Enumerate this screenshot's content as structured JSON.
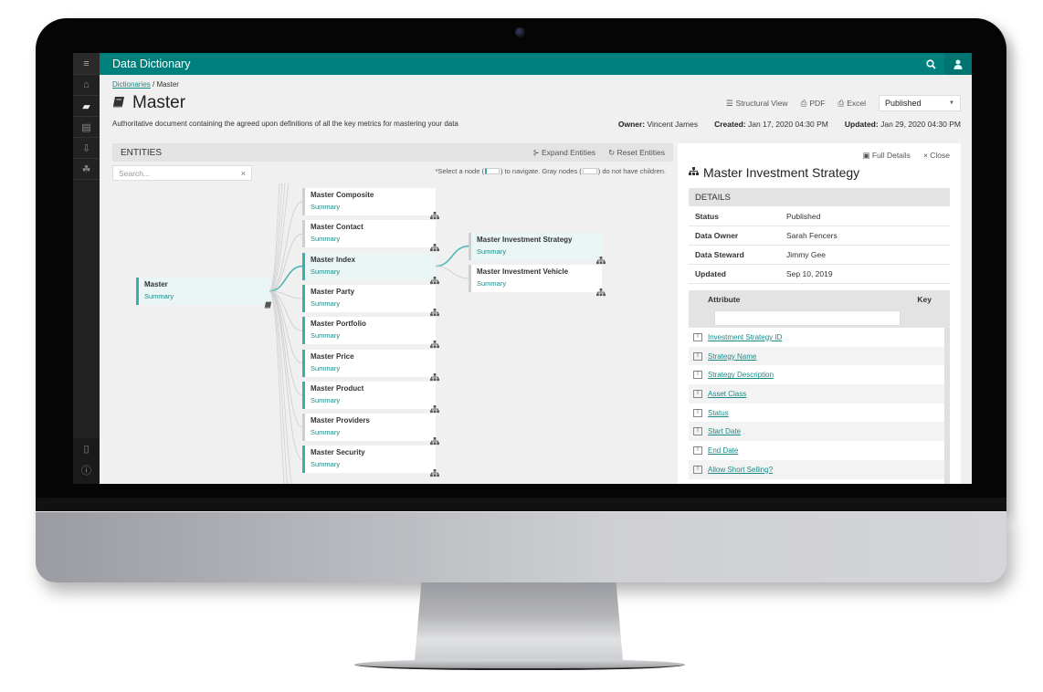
{
  "app": {
    "title": "Data Dictionary"
  },
  "sidebar": {
    "items": [
      {
        "name": "menu",
        "glyph": "≡"
      },
      {
        "name": "home",
        "glyph": "⌂"
      },
      {
        "name": "dictionaries",
        "glyph": "▰"
      },
      {
        "name": "documents",
        "glyph": "▤"
      },
      {
        "name": "import",
        "glyph": "⇩"
      },
      {
        "name": "groups",
        "glyph": "☘"
      }
    ],
    "bottom": [
      {
        "name": "device",
        "glyph": "▯"
      },
      {
        "name": "info",
        "glyph": "ⓘ"
      }
    ]
  },
  "breadcrumb": {
    "root": "Dictionaries",
    "separator": "/",
    "current": "Master"
  },
  "page": {
    "title": "Master",
    "description": "Authoritative document containing the agreed upon definitions of all the key metrics for mastering your data",
    "actions": {
      "structural_view": "Structural View",
      "pdf": "PDF",
      "excel": "Excel"
    },
    "status_select": "Published",
    "meta": {
      "owner_label": "Owner:",
      "owner": "Vincent James",
      "created_label": "Created:",
      "created": "Jan 17, 2020 04:30 PM",
      "updated_label": "Updated:",
      "updated": "Jan 29, 2020 04:30 PM"
    }
  },
  "entities": {
    "title": "ENTITIES",
    "expand": "Expand Entities",
    "reset": "Reset Entities",
    "search_placeholder": "Search...",
    "hint_a": "*Select a node (",
    "hint_b": ") to navigate. Gray nodes (",
    "hint_c": ") do not have children.",
    "root": {
      "title": "Master",
      "summary": "Summary"
    },
    "children": [
      {
        "title": "Master Composite",
        "summary": "Summary",
        "gray": true
      },
      {
        "title": "Master Contact",
        "summary": "Summary",
        "gray": true
      },
      {
        "title": "Master Index",
        "summary": "Summary",
        "gray": false,
        "selected": true
      },
      {
        "title": "Master Party",
        "summary": "Summary",
        "gray": false
      },
      {
        "title": "Master Portfolio",
        "summary": "Summary",
        "gray": false
      },
      {
        "title": "Master Price",
        "summary": "Summary",
        "gray": false
      },
      {
        "title": "Master Product",
        "summary": "Summary",
        "gray": false
      },
      {
        "title": "Master Providers",
        "summary": "Summary",
        "gray": true
      },
      {
        "title": "Master Security",
        "summary": "Summary",
        "gray": false
      }
    ],
    "grandchildren": [
      {
        "title": "Master Investment Strategy",
        "summary": "Summary",
        "gray": true,
        "selected": true
      },
      {
        "title": "Master Investment Vehicle",
        "summary": "Summary",
        "gray": true
      }
    ]
  },
  "details": {
    "full_details": "Full Details",
    "close": "Close",
    "title": "Master Investment Strategy",
    "section": "DETAILS",
    "rows": [
      {
        "k": "Status",
        "v": "Published"
      },
      {
        "k": "Data Owner",
        "v": "Sarah Fencers"
      },
      {
        "k": "Data Steward",
        "v": "Jimmy Gee"
      },
      {
        "k": "Updated",
        "v": "Sep 10, 2019"
      }
    ],
    "attr_header": "Attribute",
    "key_header": "Key",
    "attributes": [
      "Investment Strategy ID",
      "Strategy Name",
      "Strategy Description",
      "Asset Class",
      "Status",
      "Start Date",
      "End Date",
      "Allow Short Selling?"
    ]
  },
  "colors": {
    "brand": "#00807d",
    "accent": "#3ab0ab",
    "link": "#1b8a87"
  }
}
